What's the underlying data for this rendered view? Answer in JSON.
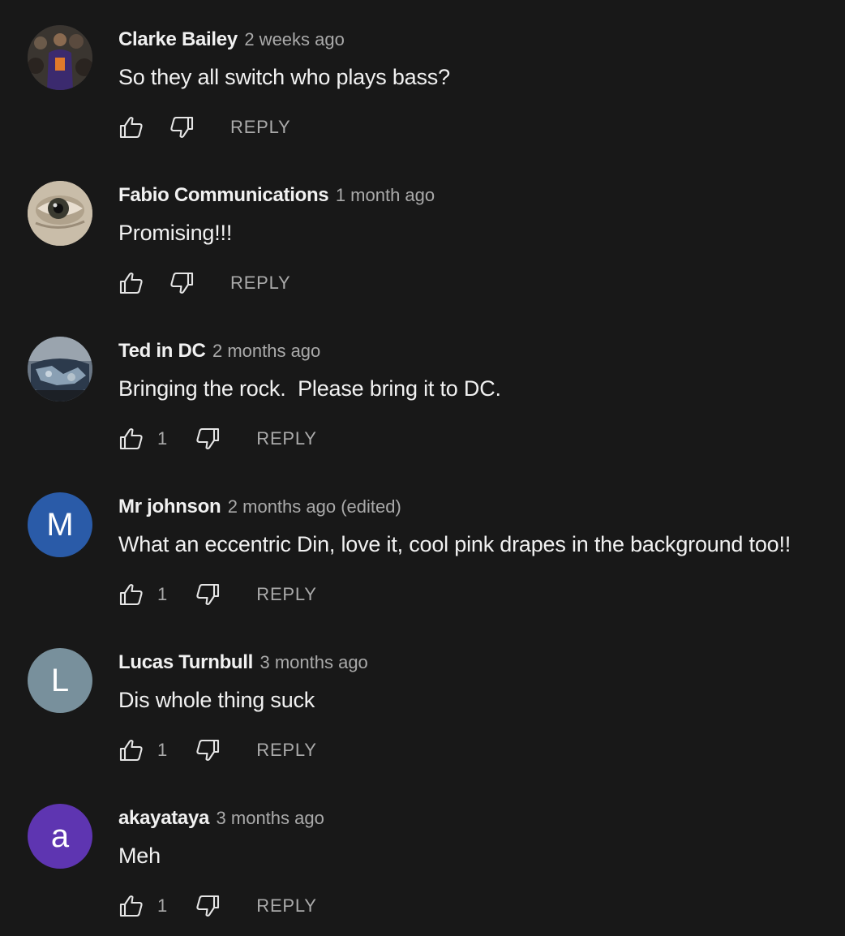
{
  "comments": [
    {
      "author": "Clarke Bailey",
      "time": "2 weeks ago",
      "text": "So they all switch who plays bass?",
      "likes": "",
      "reply_label": "REPLY",
      "avatar": {
        "type": "photo",
        "letter": ""
      }
    },
    {
      "author": "Fabio Communications",
      "time": "1 month ago",
      "text": "Promising!!!",
      "likes": "",
      "reply_label": "REPLY",
      "avatar": {
        "type": "photo",
        "letter": ""
      }
    },
    {
      "author": "Ted in DC",
      "time": "2 months ago",
      "text": "Bringing the rock.  Please bring it to DC.",
      "likes": "1",
      "reply_label": "REPLY",
      "avatar": {
        "type": "photo",
        "letter": ""
      }
    },
    {
      "author": "Mr johnson",
      "time": "2 months ago (edited)",
      "text": "What an eccentric Din, love it, cool pink drapes in the background too!!",
      "likes": "1",
      "reply_label": "REPLY",
      "avatar": {
        "type": "letter",
        "letter": "M",
        "color": "#2a5ba8"
      }
    },
    {
      "author": "Lucas Turnbull",
      "time": "3 months ago",
      "text": "Dis whole thing suck",
      "likes": "1",
      "reply_label": "REPLY",
      "avatar": {
        "type": "letter",
        "letter": "L",
        "color": "#78909c"
      }
    },
    {
      "author": "akayataya",
      "time": "3 months ago",
      "text": "Meh",
      "likes": "1",
      "reply_label": "REPLY",
      "avatar": {
        "type": "letter",
        "letter": "a",
        "color": "#5e35b1"
      }
    }
  ],
  "icons": {
    "like": "thumbs-up-icon",
    "dislike": "thumbs-down-icon"
  }
}
